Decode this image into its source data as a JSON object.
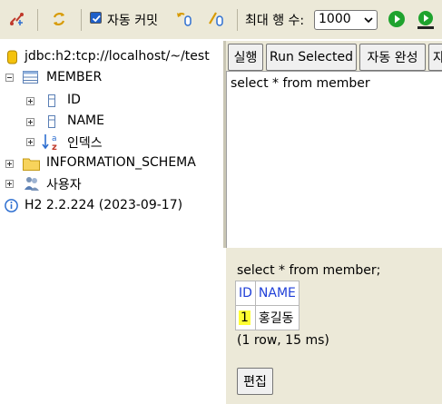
{
  "toolbar": {
    "autocommit_label": "자동 커밋",
    "autocommit_checked": true,
    "max_rows_label": "최대 행 수:",
    "max_rows_value": "1000",
    "icons": [
      "disconnect-icon",
      "refresh-icon",
      "rollback-icon",
      "commit-icon",
      "run-icon",
      "run-selected-icon"
    ]
  },
  "tree": {
    "connection": "jdbc:h2:tcp://localhost/~/test",
    "table": "MEMBER",
    "columns": [
      "ID",
      "NAME"
    ],
    "indexes": "인덱스",
    "schema": "INFORMATION_SCHEMA",
    "users": "사용자",
    "version": "H2 2.2.224 (2023-09-17)"
  },
  "editor": {
    "buttons": {
      "run": "실행",
      "run_selected": "Run Selected",
      "autocomplete": "자동 완성",
      "more": "자"
    },
    "sql": "select * from member"
  },
  "result": {
    "sql": "select * from member;",
    "columns": [
      "ID",
      "NAME"
    ],
    "rows": [
      [
        "1",
        "홍길동"
      ]
    ],
    "count": "(1 row, 15 ms)",
    "edit_label": "편집"
  },
  "colors": {
    "panel_bg": "#ece9d8",
    "header_blue": "#1f3fd8",
    "highlight": "#ffff33",
    "run_green": "#1fa32e"
  }
}
